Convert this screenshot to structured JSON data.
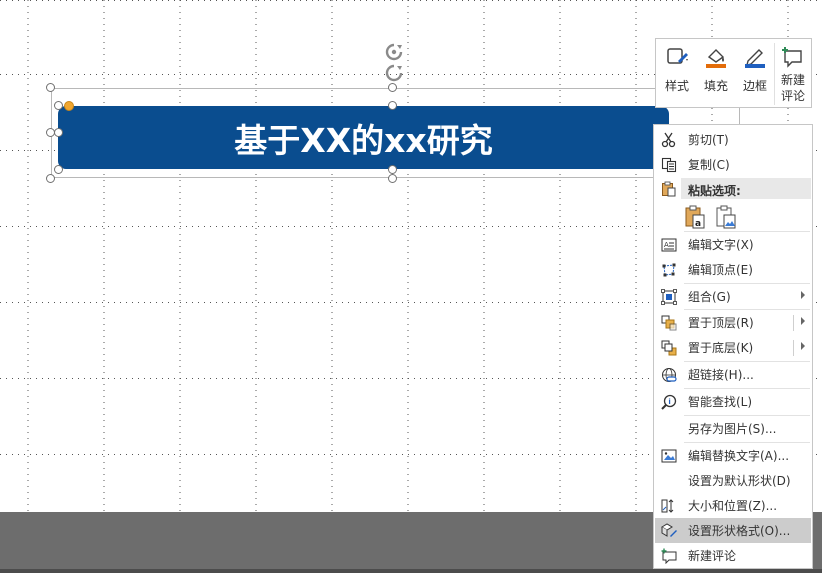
{
  "slide": {
    "title_text": "基于XX的xx研究",
    "shape_color": "#0a4d8f"
  },
  "mini_toolbar": {
    "items": [
      {
        "label": "样式",
        "icon": "shape-style-icon"
      },
      {
        "label": "填充",
        "icon": "fill-bucket-icon"
      },
      {
        "label": "边框",
        "icon": "outline-pen-icon"
      },
      {
        "label_line1": "新建",
        "label_line2": "评论",
        "icon": "new-comment-icon"
      }
    ]
  },
  "context_menu": {
    "cut": "剪切(T)",
    "copy": "复制(C)",
    "paste_options": "粘贴选项:",
    "edit_text": "编辑文字(X)",
    "edit_points": "编辑顶点(E)",
    "group": "组合(G)",
    "bring_to_front": "置于顶层(R)",
    "send_to_back": "置于底层(K)",
    "hyperlink": "超链接(H)...",
    "smart_lookup": "智能查找(L)",
    "save_as_picture": "另存为图片(S)...",
    "edit_alt_text": "编辑替换文字(A)...",
    "set_default_shape": "设置为默认形状(D)",
    "size_and_position": "大小和位置(Z)...",
    "format_shape": "设置形状格式(O)...",
    "new_comment": "新建评论"
  },
  "colors": {
    "accent_orange": "#e36c09",
    "accent_blue": "#1f5fbf",
    "comment_green": "#2e8b57"
  }
}
